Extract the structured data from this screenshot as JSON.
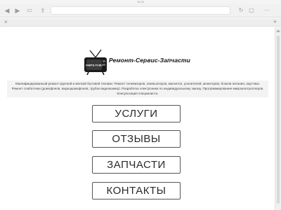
{
  "browser": {
    "clock": "18:33",
    "icons": [
      "back-arrow-icon",
      "forward-arrow-icon",
      "bookmarks-icon",
      "share-icon",
      "new-tab-icon"
    ]
  },
  "site": {
    "title": "Ремонт-Сервис-Запчасти",
    "logo_label": "PARTS-TV.RU",
    "description": "Квалифицированный ремонт крупной и мелкой бытовой техники. Ремонт телевизоров, компьютеров, магнитол, усилителей, мониторов, блоков питания, акустики. Ремонт слаботочки (домофонов, видеодомофонов, трубок видеокамер). Разработка электроники по индивидуальному заказу. Программирование микроконтроллеров. Консультация специалиста."
  },
  "menu": [
    {
      "label": "УСЛУГИ"
    },
    {
      "label": "ОТЗЫВЫ"
    },
    {
      "label": "ЗАПЧАСТИ"
    },
    {
      "label": "КОНТАКТЫ"
    }
  ]
}
